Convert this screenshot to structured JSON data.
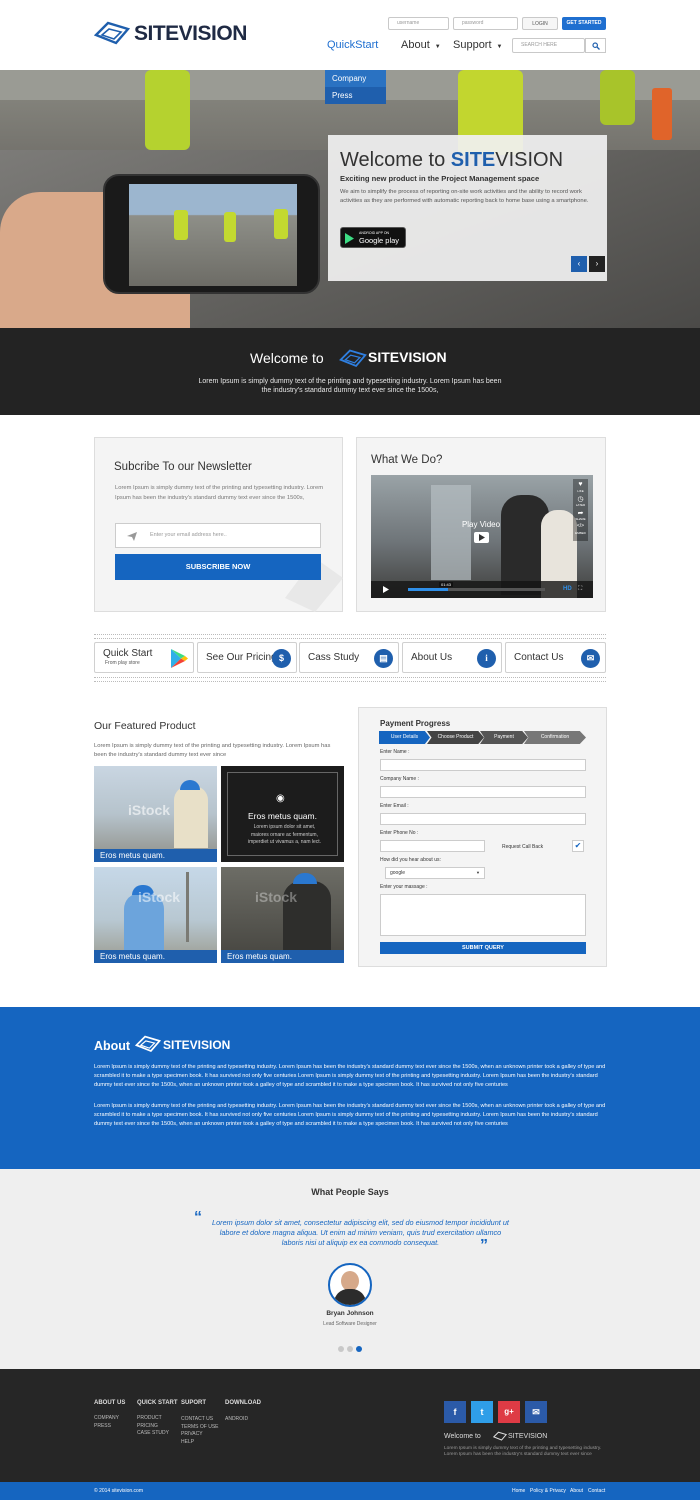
{
  "header": {
    "logo": "SITEVISION",
    "username_placeholder": "username",
    "password_placeholder": "password",
    "login_label": "LOGIN",
    "get_started_label": "GET STARTED",
    "nav": {
      "quickstart": "QuickStart",
      "about": "About",
      "support": "Support"
    },
    "search_placeholder": "SEARCH HERE",
    "dropdown": [
      "Company",
      "Press"
    ]
  },
  "hero": {
    "welcome_prefix": "Welcome to",
    "brand_a": "SITE",
    "brand_b": "VISION",
    "subtitle": "Exciting new product in the Project Management space",
    "body": "We aim to simplify the process of reporting on-site work activities and the ability to record work activities as they are performed with automatic reporting back to home base using a smartphone.",
    "badge_small": "ANDROID APP ON",
    "badge_big": "Google play",
    "prev": "‹",
    "next": "›"
  },
  "band": {
    "welcome_prefix": "Welcome to",
    "brand": "SITEVISION",
    "line1": "Lorem Ipsum is simply dummy text of the printing and typesetting industry. Lorem Ipsum has been",
    "line2": "the industry's standard dummy text ever since the 1500s,"
  },
  "newsletter": {
    "title": "Subcribe To our Newsletter",
    "body": "Lorem Ipsum is simply dummy text of the printing and typesetting industry. Lorem Ipsum has been the industry's standard dummy text ever since the 1500s,",
    "email_placeholder": "Enter your email address here..",
    "button": "SUBSCRIBE NOW"
  },
  "whatwedo": {
    "title": "What We Do?",
    "play_label": "Play Video",
    "time": "01:43",
    "side": [
      "LIKE",
      "LATER",
      "SHARE",
      "EMBED"
    ],
    "hd": "HD"
  },
  "quicklinks": [
    {
      "title": "Quick Start",
      "sub": "From play store"
    },
    {
      "title": "See Our Pricing",
      "icon": "$"
    },
    {
      "title": "Cass Study",
      "icon": "▤"
    },
    {
      "title": "About Us",
      "icon": "i"
    },
    {
      "title": "Contact Us",
      "icon": "✉"
    }
  ],
  "featured": {
    "title": "Our Featured Product",
    "body": "Lorem Ipsum is simply dummy text of the printing and typesetting industry. Lorem Ipsum has been the industry's standard dummy text ever since",
    "items": [
      "Eros metus quam.",
      "Eros metus quam.",
      "Eros metus quam.",
      "Eros metus quam."
    ],
    "overlay_title": "Eros metus quam.",
    "overlay_body": "Lorem ipsum dolor sit amet, maiores ornare ac fermentum, imperdiet ut vivamus a, nam lect.",
    "watermark": "iStock"
  },
  "payment": {
    "title": "Payment Progress",
    "steps": [
      "User Details",
      "Choose Product",
      "Payment",
      "Confirmation"
    ],
    "labels": {
      "name": "Enter Name :",
      "company": "Company Name :",
      "email": "Enter Email :",
      "phone": "Enter Phone No :",
      "callback": "Request Call Back",
      "hear": "How did you hear about us:",
      "select_value": "google",
      "message": "Enter your massage :"
    },
    "submit": "SUBMIT QUERY"
  },
  "about": {
    "title": "About",
    "brand": "SITEVISION",
    "p1": "Lorem Ipsum is simply dummy text of the printing and typesetting industry. Lorem Ipsum has been the industry's standard dummy text ever since the 1500s, when an unknown printer took a galley of type and scrambled it to make a type specimen book. It has survived not only five centuries Lorem Ipsum is simply dummy text of the printing and typesetting industry. Lorem Ipsum has been the industry's standard dummy text ever since the 1500s, when an unknown printer took a galley of type and scrambled it to make a type specimen book. It has survived not only five centuries",
    "p2": "Lorem Ipsum is simply dummy text of the printing and typesetting industry. Lorem Ipsum has been the industry's standard dummy text ever since the 1500s, when an unknown printer took a galley of type and scrambled it to make a type specimen book. It has survived not only five centuries Lorem Ipsum is simply dummy text of the printing and typesetting industry. Lorem Ipsum has been the industry's standard dummy text ever since the 1500s, when an unknown printer took a galley of type and scrambled it to make a type specimen book. It has survived not only five centuries"
  },
  "testimonial": {
    "title": "What People Says",
    "quote": "Lorem ipsum dolor sit amet, consectetur adipiscing elit, sed do eiusmod tempor incididunt ut labore et dolore magna aliqua. Ut enim ad minim veniam, quis trud exercitation ullamco laboris nisi ut aliquip ex ea commodo consequat.",
    "name": "Bryan Johnson",
    "role": "Lead Software Designer",
    "active_dot": 3,
    "dot_count": 3
  },
  "footer": {
    "cols": [
      {
        "head": "ABOUT US",
        "links": [
          "COMPANY",
          "PRESS"
        ]
      },
      {
        "head": "QUICK START",
        "links": [
          "PRODUCT",
          "PRICING",
          "CASE STUDY"
        ]
      },
      {
        "head": "SUPORT",
        "links": [
          "CONTACT US",
          "TERMS OF USE",
          "PRIVACY",
          "HELP"
        ]
      },
      {
        "head": "DOWNLOAD",
        "links": [
          "ANDROID"
        ]
      }
    ],
    "social": [
      "f",
      "t",
      "g+",
      "✉"
    ],
    "welcome_prefix": "Welcome to",
    "brand": "SITEVISION",
    "blurb": "Lorem Ipsum is simply dummy text of the printing and typesetting industry. Lorem Ipsum has been the industry's standard dummy text ever since"
  },
  "bottom": {
    "copyright": "© 2014 sitevision.com",
    "links": [
      "Home",
      "Policy & Privacy",
      "About",
      "Contact"
    ]
  },
  "colors": {
    "accent": "#1f5fad",
    "about_bg": "#1565c0",
    "dark": "#232323"
  }
}
